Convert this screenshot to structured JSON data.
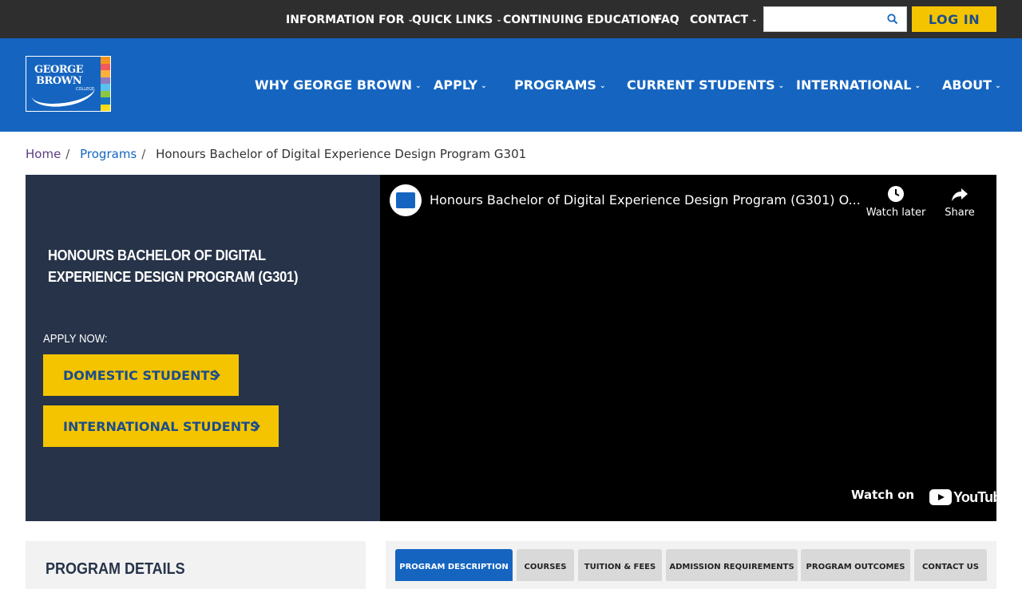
{
  "utility_nav": {
    "items": [
      {
        "label": "INFORMATION FOR",
        "has_dropdown": true
      },
      {
        "label": "QUICK LINKS",
        "has_dropdown": true
      },
      {
        "label": "CONTINUING EDUCATION",
        "has_dropdown": false
      },
      {
        "label": "FAQ",
        "has_dropdown": false
      },
      {
        "label": "CONTACT",
        "has_dropdown": true
      }
    ],
    "search": {
      "placeholder": "",
      "value": "",
      "icon": "search-icon"
    },
    "login_label": "LOG IN"
  },
  "main_nav": {
    "logo": {
      "line1": "GEORGE",
      "line2": "BROWN",
      "sub": "COLLEGE",
      "stripe_colors": [
        "#f7941d",
        "#f15a5a",
        "#fbb03b",
        "#8e7cc3",
        "#5bc0eb",
        "#8dc63f",
        "#1b75bc",
        "#ffde17"
      ]
    },
    "items": [
      {
        "label": "WHY GEORGE BROWN"
      },
      {
        "label": "APPLY"
      },
      {
        "label": "PROGRAMS"
      },
      {
        "label": "CURRENT STUDENTS"
      },
      {
        "label": "INTERNATIONAL"
      },
      {
        "label": "ABOUT"
      }
    ]
  },
  "breadcrumb": {
    "home": "Home",
    "programs": "Programs",
    "current": "Honours Bachelor of Digital Experience Design Program G301"
  },
  "hero": {
    "title": "HONOURS BACHELOR OF DIGITAL EXPERIENCE DESIGN PROGRAM (G301)",
    "apply_label": "APPLY NOW:",
    "domestic_button": "DOMESTIC STUDENTS",
    "international_button": "INTERNATIONAL STUDENTS"
  },
  "video": {
    "title": "Honours Bachelor of Digital Experience Design Program (G301) O...",
    "watch_later": "Watch later",
    "share": "Share",
    "watch_on": "Watch on",
    "youtube": "YouTube"
  },
  "details": {
    "title": "PROGRAM DETAILS"
  },
  "tabs": [
    {
      "label": "PROGRAM DESCRIPTION",
      "active": true
    },
    {
      "label": "COURSES",
      "active": false
    },
    {
      "label": "TUITION & FEES",
      "active": false
    },
    {
      "label": "ADMISSION REQUIREMENTS",
      "active": false
    },
    {
      "label": "PROGRAM OUTCOMES",
      "active": false
    },
    {
      "label": "CONTACT US",
      "active": false
    }
  ],
  "colors": {
    "topbar": "#2e2e2e",
    "nav_blue": "#1565c0",
    "hero_navy": "#263349",
    "accent_yellow": "#f5c400"
  }
}
